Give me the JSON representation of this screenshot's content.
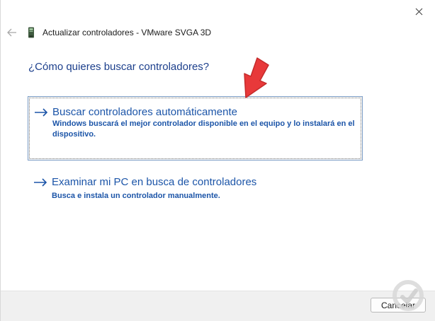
{
  "window": {
    "title": "Actualizar controladores - VMware SVGA 3D"
  },
  "main": {
    "question": "¿Cómo quieres buscar controladores?",
    "options": [
      {
        "title": "Buscar controladores automáticamente",
        "description": "Windows buscará el mejor controlador disponible en el equipo y lo instalará en el dispositivo.",
        "selected": true
      },
      {
        "title": "Examinar mi PC en busca de controladores",
        "description": "Busca e instala un controlador manualmente.",
        "selected": false
      }
    ]
  },
  "footer": {
    "cancel_label": "Cancelar"
  },
  "icons": {
    "close": "close-icon",
    "back": "back-arrow-icon",
    "device": "device-icon",
    "option_arrow": "right-arrow-icon",
    "annotation": "red-pointer-arrow"
  },
  "colors": {
    "link_blue": "#1c55a8",
    "heading_blue": "#1c3f8c",
    "annotation_red": "#e8393a",
    "footer_bg": "#f0f0f0"
  }
}
